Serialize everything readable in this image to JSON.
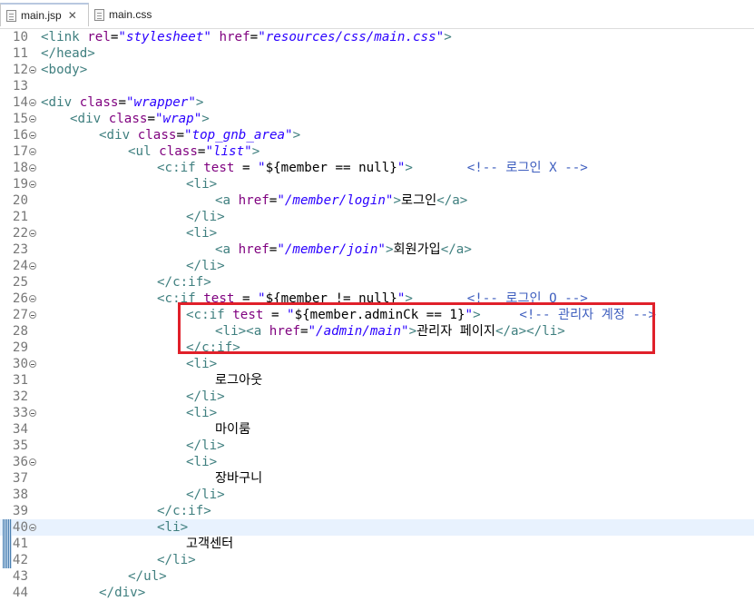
{
  "tabs": [
    {
      "label": "main.jsp",
      "active": true,
      "close": "✕"
    },
    {
      "label": "main.css",
      "active": false
    }
  ],
  "editor": {
    "lines": [
      {
        "n": "10",
        "fold": false,
        "indent": 0,
        "segs": [
          [
            "tg",
            "<link "
          ],
          [
            "at",
            "rel"
          ],
          [
            "tx",
            "="
          ],
          [
            "av",
            "\"stylesheet\""
          ],
          [
            "tx",
            " "
          ],
          [
            "at",
            "href"
          ],
          [
            "tx",
            "="
          ],
          [
            "av",
            "\"resources/css/main.css\""
          ],
          [
            "tg",
            ">"
          ]
        ]
      },
      {
        "n": "11",
        "fold": false,
        "indent": 0,
        "segs": [
          [
            "tg",
            "</head>"
          ]
        ]
      },
      {
        "n": "12",
        "fold": true,
        "indent": 0,
        "segs": [
          [
            "tg",
            "<body>"
          ]
        ]
      },
      {
        "n": "13",
        "fold": false,
        "indent": 0,
        "segs": []
      },
      {
        "n": "14",
        "fold": true,
        "indent": 0,
        "segs": [
          [
            "tg",
            "<div "
          ],
          [
            "at",
            "class"
          ],
          [
            "tx",
            "="
          ],
          [
            "av",
            "\"wrapper\""
          ],
          [
            "tg",
            ">"
          ]
        ]
      },
      {
        "n": "15",
        "fold": true,
        "indent": 1,
        "segs": [
          [
            "tg",
            "<div "
          ],
          [
            "at",
            "class"
          ],
          [
            "tx",
            "="
          ],
          [
            "av",
            "\"wrap\""
          ],
          [
            "tg",
            ">"
          ]
        ]
      },
      {
        "n": "16",
        "fold": true,
        "indent": 2,
        "segs": [
          [
            "tg",
            "<div "
          ],
          [
            "at",
            "class"
          ],
          [
            "tx",
            "="
          ],
          [
            "av",
            "\"top_gnb_area\""
          ],
          [
            "tg",
            ">"
          ]
        ]
      },
      {
        "n": "17",
        "fold": true,
        "indent": 3,
        "segs": [
          [
            "tg",
            "<ul "
          ],
          [
            "at",
            "class"
          ],
          [
            "tx",
            "="
          ],
          [
            "av",
            "\"list\""
          ],
          [
            "tg",
            ">"
          ]
        ]
      },
      {
        "n": "18",
        "fold": true,
        "indent": 4,
        "segs": [
          [
            "tg",
            "<c:if "
          ],
          [
            "at",
            "test"
          ],
          [
            "tx",
            " = "
          ],
          [
            "av",
            "\""
          ],
          [
            "el",
            "${member == null}"
          ],
          [
            "av",
            "\""
          ],
          [
            "tg",
            ">"
          ],
          [
            "tx",
            "       "
          ],
          [
            "cm",
            "<!-- 로그인 X -->"
          ]
        ]
      },
      {
        "n": "19",
        "fold": true,
        "indent": 5,
        "segs": [
          [
            "tg",
            "<li>"
          ]
        ]
      },
      {
        "n": "20",
        "fold": false,
        "indent": 6,
        "segs": [
          [
            "tg",
            "<a "
          ],
          [
            "at",
            "href"
          ],
          [
            "tx",
            "="
          ],
          [
            "av",
            "\"/member/login\""
          ],
          [
            "tg",
            ">"
          ],
          [
            "tx",
            "로그인"
          ],
          [
            "tg",
            "</a>"
          ]
        ]
      },
      {
        "n": "21",
        "fold": false,
        "indent": 5,
        "segs": [
          [
            "tg",
            "</li>"
          ]
        ]
      },
      {
        "n": "22",
        "fold": true,
        "indent": 5,
        "segs": [
          [
            "tg",
            "<li>"
          ]
        ]
      },
      {
        "n": "23",
        "fold": false,
        "indent": 6,
        "segs": [
          [
            "tg",
            "<a "
          ],
          [
            "at",
            "href"
          ],
          [
            "tx",
            "="
          ],
          [
            "av",
            "\"/member/join\""
          ],
          [
            "tg",
            ">"
          ],
          [
            "tx",
            "회원가입"
          ],
          [
            "tg",
            "</a>"
          ]
        ]
      },
      {
        "n": "24",
        "fold": true,
        "indent": 5,
        "segs": [
          [
            "tg",
            "</li>"
          ]
        ]
      },
      {
        "n": "25",
        "fold": false,
        "indent": 4,
        "segs": [
          [
            "tg",
            "</c:if>"
          ]
        ]
      },
      {
        "n": "26",
        "fold": true,
        "indent": 4,
        "segs": [
          [
            "tg",
            "<c:if "
          ],
          [
            "at",
            "test"
          ],
          [
            "tx",
            " = "
          ],
          [
            "av",
            "\""
          ],
          [
            "el",
            "${member != null}"
          ],
          [
            "av",
            "\""
          ],
          [
            "tg",
            ">"
          ],
          [
            "tx",
            "       "
          ],
          [
            "cm",
            "<!-- 로그인 O -->"
          ]
        ]
      },
      {
        "n": "27",
        "fold": true,
        "indent": 5,
        "segs": [
          [
            "tg",
            "<c:if "
          ],
          [
            "at",
            "test"
          ],
          [
            "tx",
            " = "
          ],
          [
            "av",
            "\""
          ],
          [
            "el",
            "${member.adminCk == 1}"
          ],
          [
            "av",
            "\""
          ],
          [
            "tg",
            ">"
          ],
          [
            "tx",
            "     "
          ],
          [
            "cm",
            "<!-- 관리자 계정 -->"
          ]
        ]
      },
      {
        "n": "28",
        "fold": false,
        "indent": 6,
        "segs": [
          [
            "tg",
            "<li><a "
          ],
          [
            "at",
            "href"
          ],
          [
            "tx",
            "="
          ],
          [
            "av",
            "\"/admin/main\""
          ],
          [
            "tg",
            ">"
          ],
          [
            "tx",
            "관리자 페이지"
          ],
          [
            "tg",
            "</a></li>"
          ]
        ]
      },
      {
        "n": "29",
        "fold": false,
        "indent": 5,
        "segs": [
          [
            "tg",
            "</c:if>"
          ]
        ]
      },
      {
        "n": "30",
        "fold": true,
        "indent": 5,
        "segs": [
          [
            "tg",
            "<li>"
          ]
        ]
      },
      {
        "n": "31",
        "fold": false,
        "indent": 6,
        "segs": [
          [
            "tx",
            "로그아웃"
          ]
        ]
      },
      {
        "n": "32",
        "fold": false,
        "indent": 5,
        "segs": [
          [
            "tg",
            "</li>"
          ]
        ]
      },
      {
        "n": "33",
        "fold": true,
        "indent": 5,
        "segs": [
          [
            "tg",
            "<li>"
          ]
        ]
      },
      {
        "n": "34",
        "fold": false,
        "indent": 6,
        "segs": [
          [
            "tx",
            "마이룸"
          ]
        ]
      },
      {
        "n": "35",
        "fold": false,
        "indent": 5,
        "segs": [
          [
            "tg",
            "</li>"
          ]
        ]
      },
      {
        "n": "36",
        "fold": true,
        "indent": 5,
        "segs": [
          [
            "tg",
            "<li>"
          ]
        ]
      },
      {
        "n": "37",
        "fold": false,
        "indent": 6,
        "segs": [
          [
            "tx",
            "장바구니"
          ]
        ]
      },
      {
        "n": "38",
        "fold": false,
        "indent": 5,
        "segs": [
          [
            "tg",
            "</li>"
          ]
        ]
      },
      {
        "n": "39",
        "fold": false,
        "indent": 4,
        "segs": [
          [
            "tg",
            "</c:if>"
          ]
        ]
      },
      {
        "n": "40",
        "fold": true,
        "indent": 4,
        "hl": true,
        "mark": true,
        "segs": [
          [
            "tg",
            "<li>"
          ]
        ]
      },
      {
        "n": "41",
        "fold": false,
        "indent": 5,
        "mark": true,
        "segs": [
          [
            "tx",
            "고객센터"
          ]
        ]
      },
      {
        "n": "42",
        "fold": false,
        "indent": 4,
        "mark": true,
        "segs": [
          [
            "tg",
            "</li>"
          ]
        ]
      },
      {
        "n": "43",
        "fold": false,
        "indent": 3,
        "segs": [
          [
            "tg",
            "</ul>"
          ]
        ]
      },
      {
        "n": "44",
        "fold": false,
        "indent": 2,
        "segs": [
          [
            "tg",
            "</div>"
          ]
        ]
      }
    ]
  }
}
